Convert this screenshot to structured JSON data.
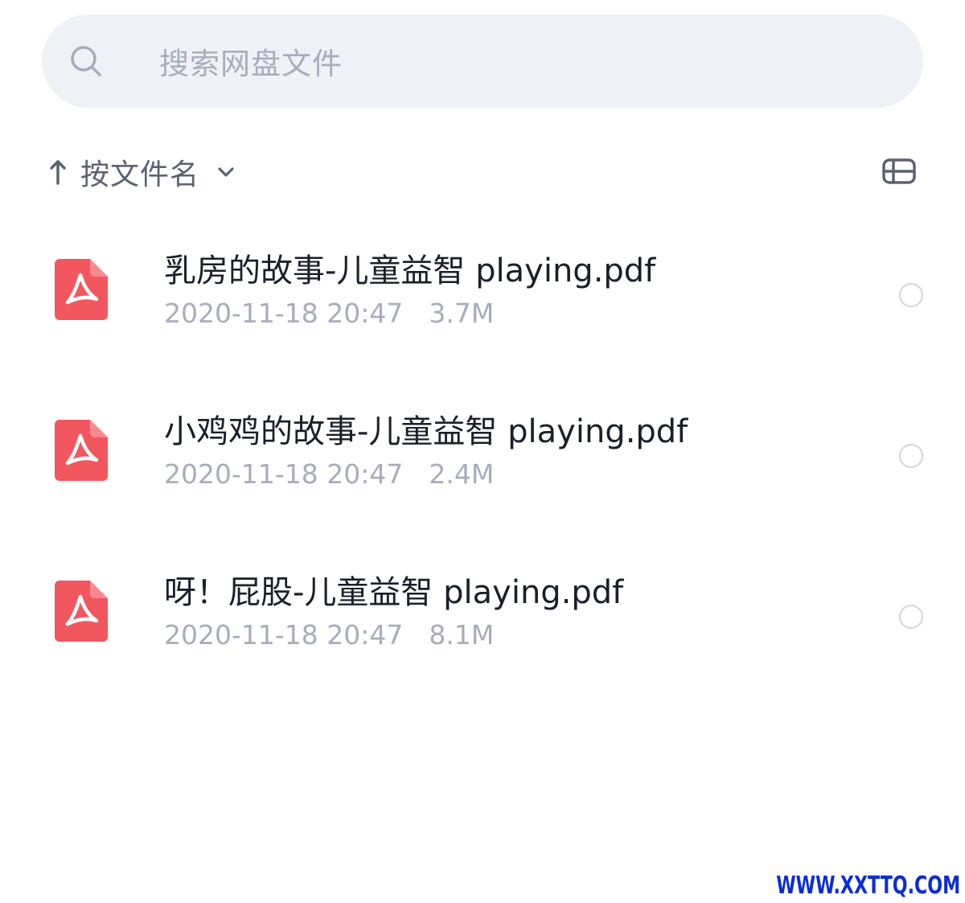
{
  "search": {
    "placeholder": "搜索网盘文件",
    "icon": "search-icon"
  },
  "sort": {
    "direction_icon": "arrow-up-icon",
    "label": "按文件名",
    "dropdown_icon": "chevron-down-icon"
  },
  "view_toggle": {
    "icon": "list-view-icon"
  },
  "files": [
    {
      "name": "乳房的故事-儿童益智 playing.pdf",
      "date": "2020-11-18 20:47",
      "size": "3.7M",
      "icon": "pdf-file-icon",
      "selected": false
    },
    {
      "name": "小鸡鸡的故事-儿童益智 playing.pdf",
      "date": "2020-11-18 20:47",
      "size": "2.4M",
      "icon": "pdf-file-icon",
      "selected": false
    },
    {
      "name": "呀！屁股-儿童益智 playing.pdf",
      "date": "2020-11-18 20:47",
      "size": "8.1M",
      "icon": "pdf-file-icon",
      "selected": false
    }
  ],
  "watermark": "WWW.XXTTQ.COM",
  "colors": {
    "search_bg": "#eff1f7",
    "placeholder_text": "#a8adbb",
    "primary_text": "#1b1f2a",
    "secondary_text": "#5c6273",
    "pdf_red": "#f2565f",
    "checkbox_border": "#d2d5dd",
    "watermark_blue": "#0b2dd6"
  }
}
